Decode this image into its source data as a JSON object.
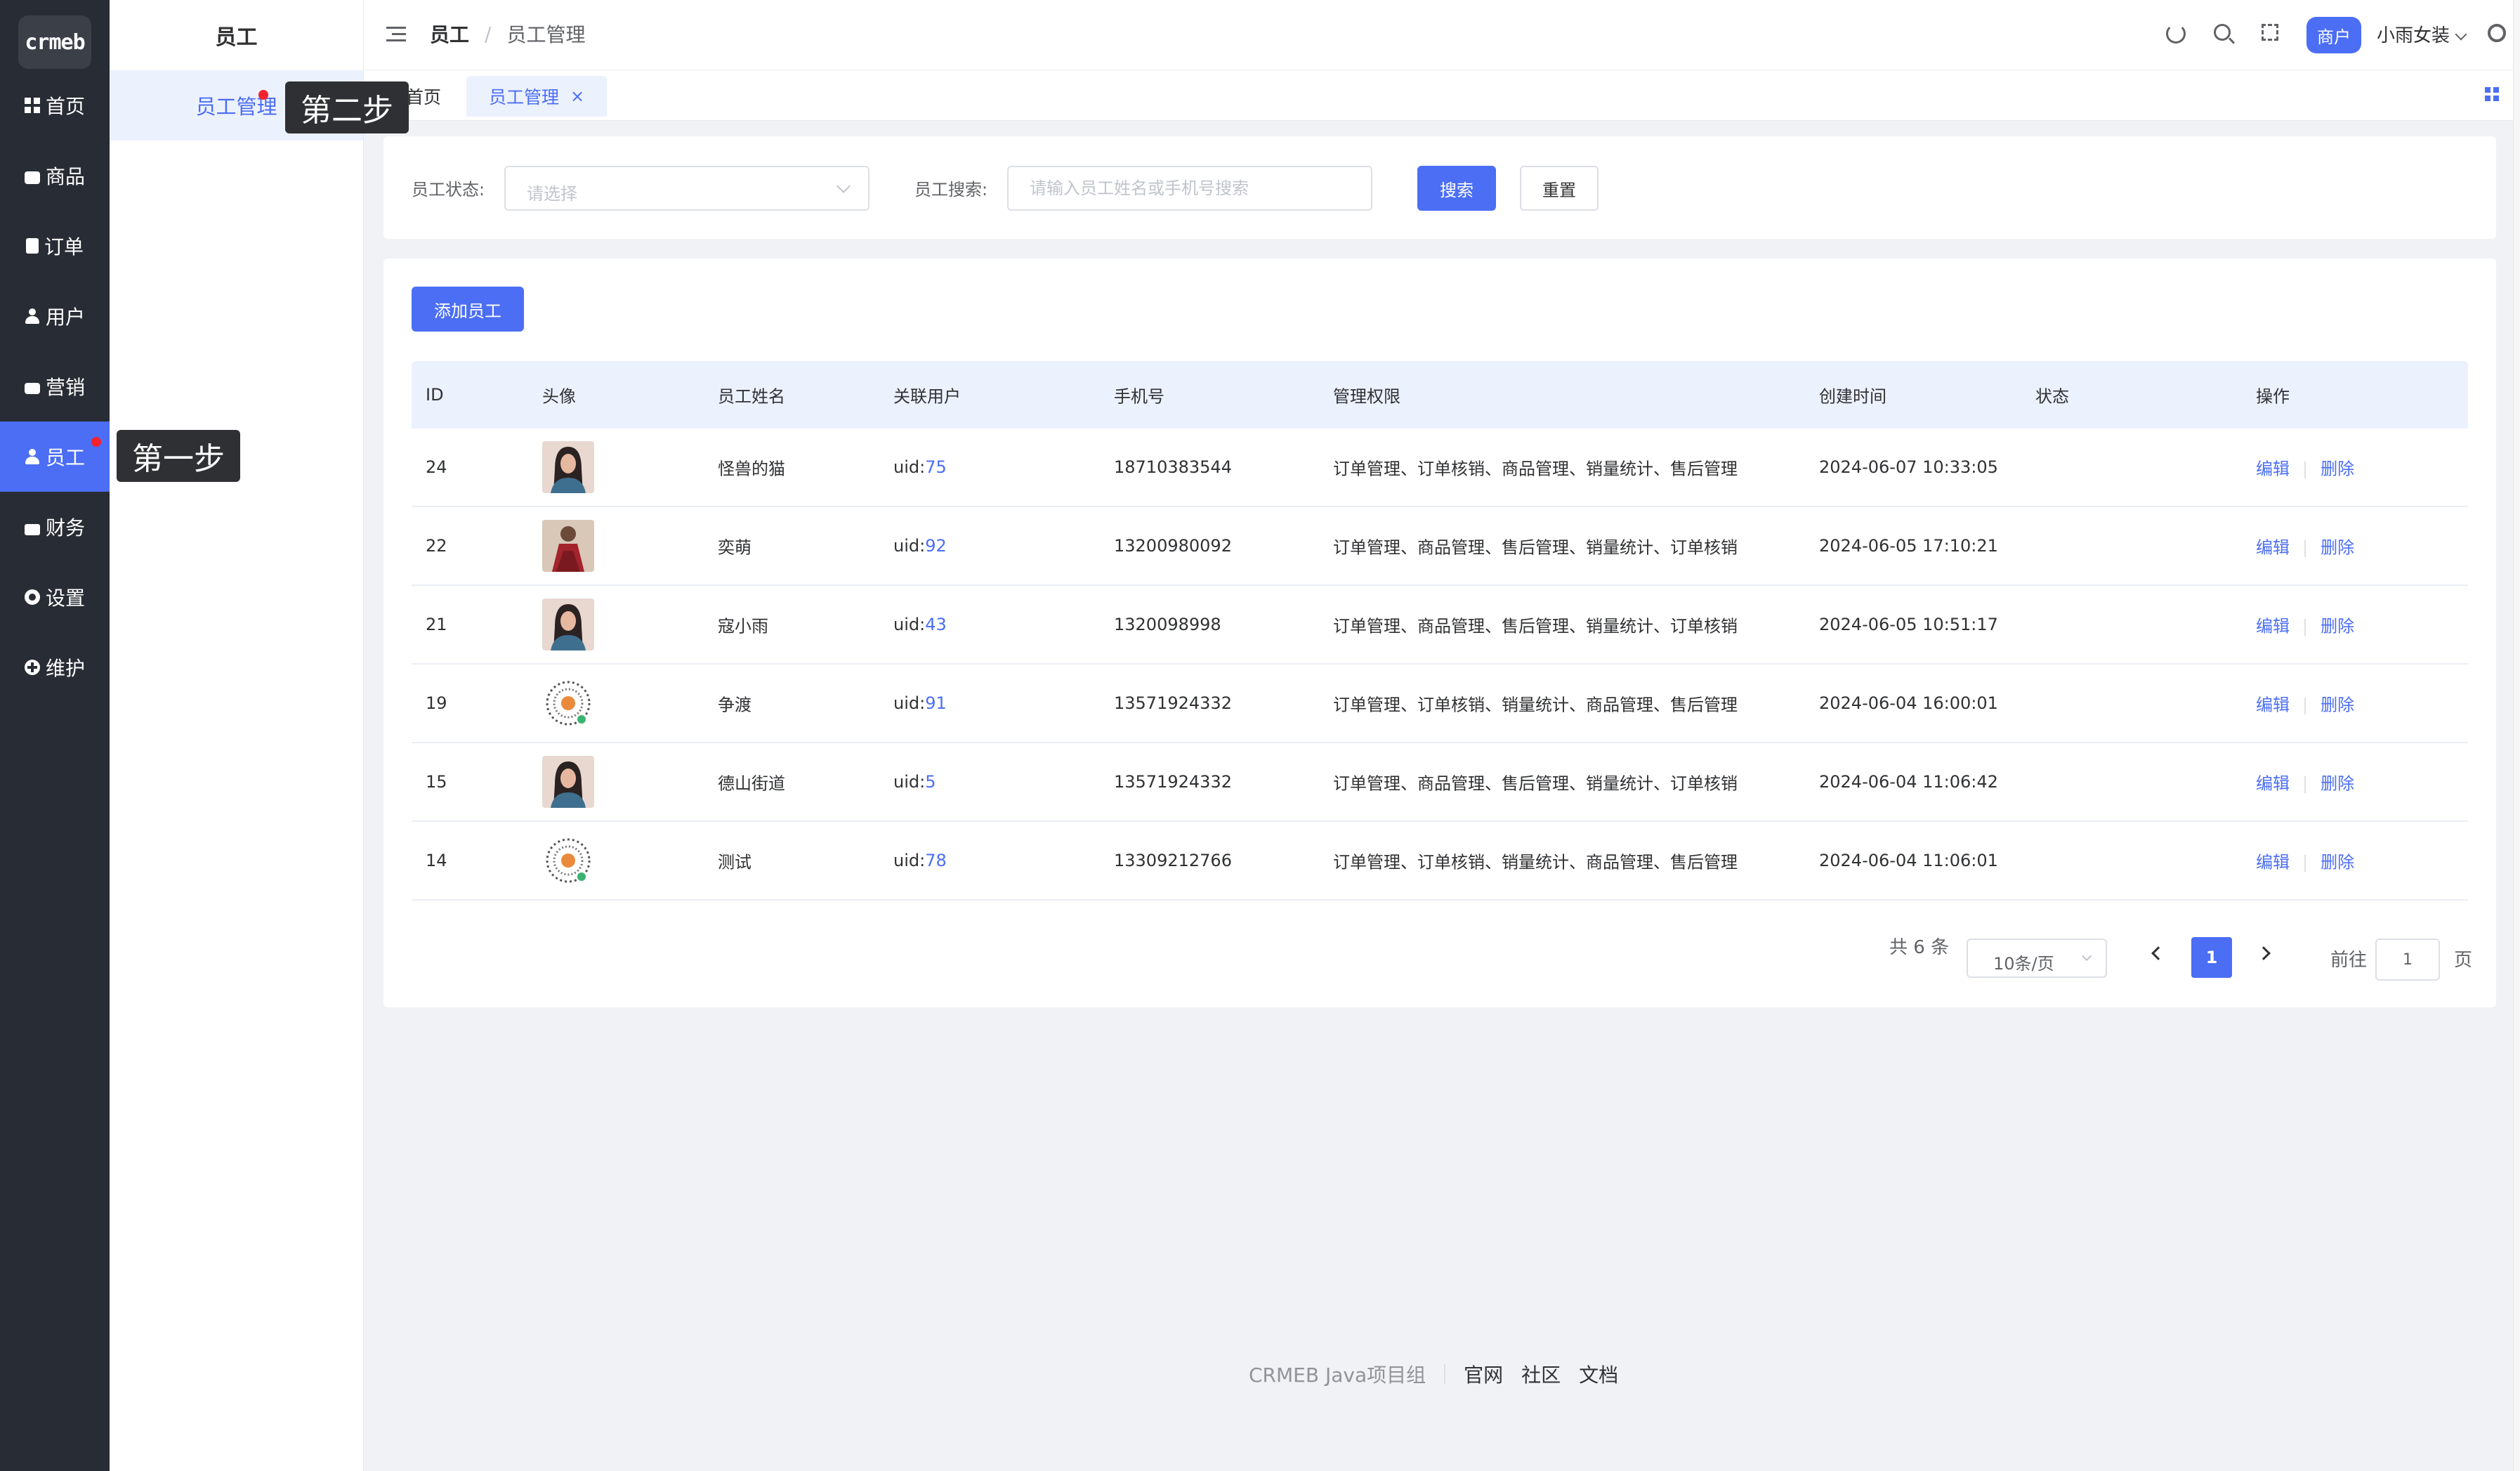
{
  "rail": {
    "logo": "crmeb",
    "items": [
      {
        "label": "首页",
        "icon": "grid-icon"
      },
      {
        "label": "商品",
        "icon": "bag-icon"
      },
      {
        "label": "订单",
        "icon": "order-icon"
      },
      {
        "label": "用户",
        "icon": "user-icon"
      },
      {
        "label": "营销",
        "icon": "marketing-icon"
      },
      {
        "label": "员工",
        "icon": "staff-icon",
        "active": true
      },
      {
        "label": "财务",
        "icon": "wallet-icon"
      },
      {
        "label": "设置",
        "icon": "gear-icon"
      },
      {
        "label": "维护",
        "icon": "plus-circle-icon"
      }
    ]
  },
  "submenu": {
    "title": "员工",
    "items": [
      {
        "label": "员工管理"
      }
    ]
  },
  "header": {
    "breadcrumb": [
      "员工",
      "/",
      "员工管理"
    ],
    "merchant_label": "商户",
    "store_name": "小雨女装"
  },
  "tags": {
    "home": "首页",
    "active": "员工管理",
    "close": "×"
  },
  "filter": {
    "status_label": "员工状态:",
    "status_placeholder": "请选择",
    "search_label": "员工搜索:",
    "search_placeholder": "请输入员工姓名或手机号搜索",
    "search_button": "搜索",
    "reset_button": "重置"
  },
  "add_button": "添加员工",
  "table": {
    "columns": [
      "ID",
      "头像",
      "员工姓名",
      "关联用户",
      "手机号",
      "管理权限",
      "创建时间",
      "状态",
      "操作"
    ],
    "rows": [
      {
        "id": "24",
        "avatar": "avatar-woman",
        "name": "怪兽的猫",
        "uid_prefix": "uid:",
        "uid": "75",
        "phone": "18710383544",
        "perms": "订单管理、订单核销、商品管理、销量统计、售后管理",
        "created": "2024-06-07 10:33:05",
        "status": true,
        "edit": "编辑",
        "delete": "删除"
      },
      {
        "id": "22",
        "avatar": "avatar-dress",
        "name": "奕萌",
        "uid_prefix": "uid:",
        "uid": "92",
        "phone": "13200980092",
        "perms": "订单管理、商品管理、售后管理、销量统计、订单核销",
        "created": "2024-06-05 17:10:21",
        "status": true,
        "edit": "编辑",
        "delete": "删除"
      },
      {
        "id": "21",
        "avatar": "avatar-woman",
        "name": "寇小雨",
        "uid_prefix": "uid:",
        "uid": "43",
        "phone": "1320098998",
        "perms": "订单管理、商品管理、售后管理、销量统计、订单核销",
        "created": "2024-06-05 10:51:17",
        "status": true,
        "edit": "编辑",
        "delete": "删除"
      },
      {
        "id": "19",
        "avatar": "avatar-qr",
        "name": "争渡",
        "uid_prefix": "uid:",
        "uid": "91",
        "phone": "13571924332",
        "perms": "订单管理、订单核销、销量统计、商品管理、售后管理",
        "created": "2024-06-04 16:00:01",
        "status": true,
        "edit": "编辑",
        "delete": "删除"
      },
      {
        "id": "15",
        "avatar": "avatar-woman",
        "name": "德山街道",
        "uid_prefix": "uid:",
        "uid": "5",
        "phone": "13571924332",
        "perms": "订单管理、商品管理、售后管理、销量统计、订单核销",
        "created": "2024-06-04 11:06:42",
        "status": true,
        "edit": "编辑",
        "delete": "删除"
      },
      {
        "id": "14",
        "avatar": "avatar-qr",
        "name": "测试",
        "uid_prefix": "uid:",
        "uid": "78",
        "phone": "13309212766",
        "perms": "订单管理、订单核销、销量统计、商品管理、售后管理",
        "created": "2024-06-04 11:06:01",
        "status": true,
        "edit": "编辑",
        "delete": "删除"
      }
    ]
  },
  "pagination": {
    "total": "共 6 条",
    "page_size": "10条/页",
    "current": "1",
    "goto_label": "前往",
    "goto_value": "1",
    "page_suffix": "页"
  },
  "footer": {
    "company": "CRMEB Java项目组",
    "links": [
      "官网",
      "社区",
      "文档"
    ]
  },
  "annotations": {
    "step1": "第一步",
    "step2": "第二步"
  },
  "colors": {
    "primary": "#4b6ef5",
    "rail_bg": "#282c34",
    "page_bg": "#f0f2f5"
  }
}
